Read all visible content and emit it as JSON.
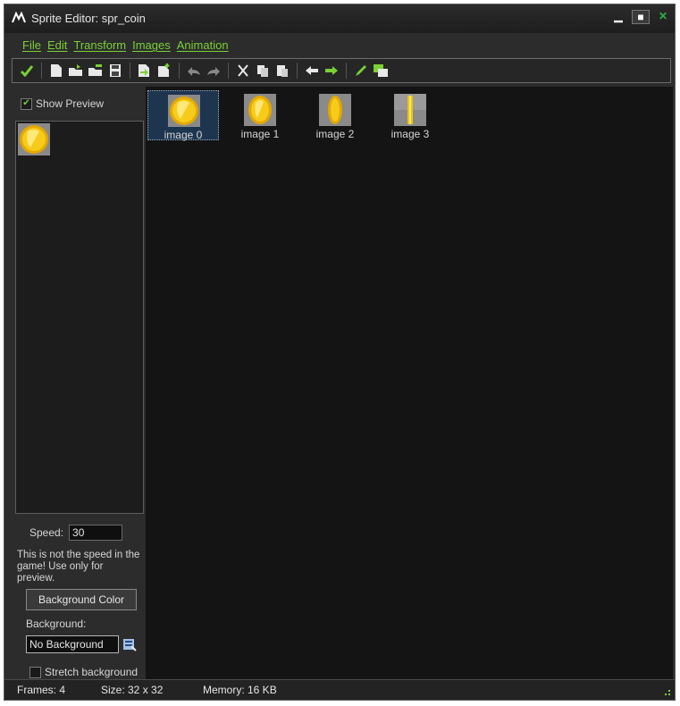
{
  "window": {
    "title": "Sprite Editor: spr_coin",
    "controls": [
      "minimize",
      "maximize",
      "close"
    ]
  },
  "menu": [
    "File",
    "Edit",
    "Transform",
    "Images",
    "Animation"
  ],
  "toolbar": {
    "icons": [
      "confirm-icon",
      "new-icon",
      "open-icon",
      "open-strip-icon",
      "save-icon",
      "import-icon",
      "add-image-icon",
      "undo-icon",
      "redo-icon",
      "cut-icon",
      "copy-icon",
      "paste-icon",
      "shift-left-icon",
      "shift-right-icon",
      "edit-icon",
      "image-layers-icon"
    ]
  },
  "left_panel": {
    "show_preview_label": "Show Preview",
    "show_preview_checked": true,
    "speed_label": "Speed:",
    "speed_value": "30",
    "note": "This is not the speed in the game! Use only for preview.",
    "background_color_button": "Background Color",
    "background_label": "Background:",
    "background_value": "No Background",
    "stretch_label": "Stretch background",
    "stretch_checked": false
  },
  "frames": [
    {
      "label": "image 0",
      "selected": true
    },
    {
      "label": "image 1",
      "selected": false
    },
    {
      "label": "image 2",
      "selected": false
    },
    {
      "label": "image 3",
      "selected": false
    }
  ],
  "status": {
    "frames": "Frames: 4",
    "size": "Size: 32 x 32",
    "memory": "Memory: 16 KB"
  },
  "colors": {
    "accent_green": "#7ad135",
    "coin_gold": "#f2c400",
    "background_dark": "#141414"
  }
}
